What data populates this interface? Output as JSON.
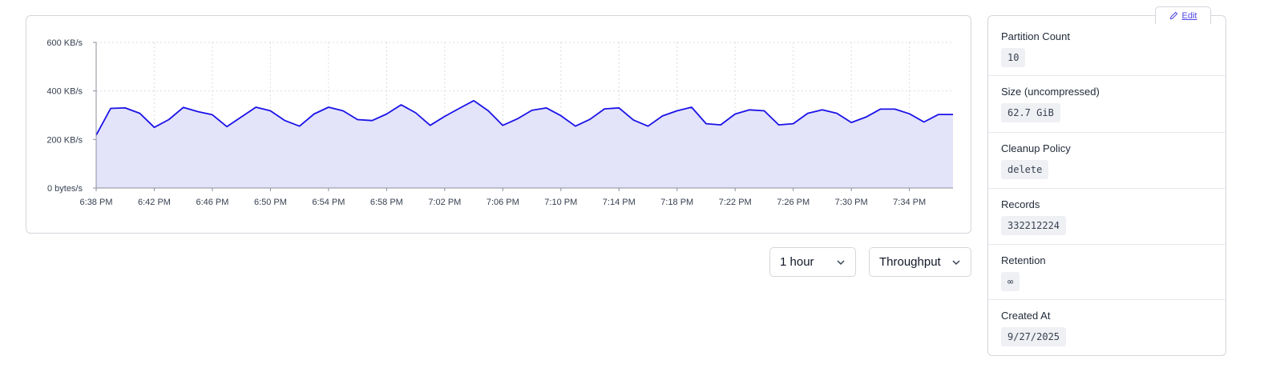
{
  "chart_data": {
    "type": "area",
    "x_ticks": [
      "6:38 PM",
      "6:42 PM",
      "6:46 PM",
      "6:50 PM",
      "6:54 PM",
      "6:58 PM",
      "7:02 PM",
      "7:06 PM",
      "7:10 PM",
      "7:14 PM",
      "7:18 PM",
      "7:22 PM",
      "7:26 PM",
      "7:30 PM",
      "7:34 PM"
    ],
    "y_ticks": [
      "0 bytes/s",
      "200 KB/s",
      "400 KB/s",
      "600 KB/s"
    ],
    "ylim": [
      0,
      600
    ],
    "x_range_minutes": [
      0,
      59
    ],
    "x": [
      0,
      1,
      2,
      3,
      4,
      5,
      6,
      7,
      8,
      9,
      10,
      11,
      12,
      13,
      14,
      15,
      16,
      17,
      18,
      19,
      20,
      21,
      22,
      23,
      24,
      25,
      26,
      27,
      28,
      29,
      30,
      31,
      32,
      33,
      34,
      35,
      36,
      37,
      38,
      39,
      40,
      41,
      42,
      43,
      44,
      45,
      46,
      47,
      48,
      49,
      50,
      51,
      52,
      53,
      54,
      55,
      56,
      57,
      58,
      59
    ],
    "values": [
      218,
      328,
      330,
      308,
      250,
      282,
      332,
      315,
      302,
      253,
      293,
      333,
      318,
      278,
      255,
      305,
      333,
      318,
      282,
      278,
      305,
      343,
      310,
      258,
      295,
      328,
      360,
      318,
      258,
      285,
      320,
      330,
      298,
      255,
      283,
      326,
      330,
      280,
      255,
      297,
      318,
      333,
      265,
      260,
      305,
      322,
      318,
      260,
      265,
      308,
      322,
      308,
      270,
      292,
      325,
      325,
      306,
      272,
      303,
      303
    ],
    "grid": true,
    "colors": {
      "line": "#1a12e8",
      "fill": "#e3e3f9",
      "grid": "#dcdde3",
      "axis": "#8a8f9a"
    }
  },
  "controls": {
    "range_label": "1 hour",
    "metric_label": "Throughput"
  },
  "edit_label": "Edit",
  "properties": [
    {
      "name": "Partition Count",
      "value": "10"
    },
    {
      "name": "Size (uncompressed)",
      "value": "62.7 GiB"
    },
    {
      "name": "Cleanup Policy",
      "value": "delete"
    },
    {
      "name": "Records",
      "value": "332212224"
    },
    {
      "name": "Retention",
      "value": "∞"
    },
    {
      "name": "Created At",
      "value": "9/27/2025"
    }
  ]
}
